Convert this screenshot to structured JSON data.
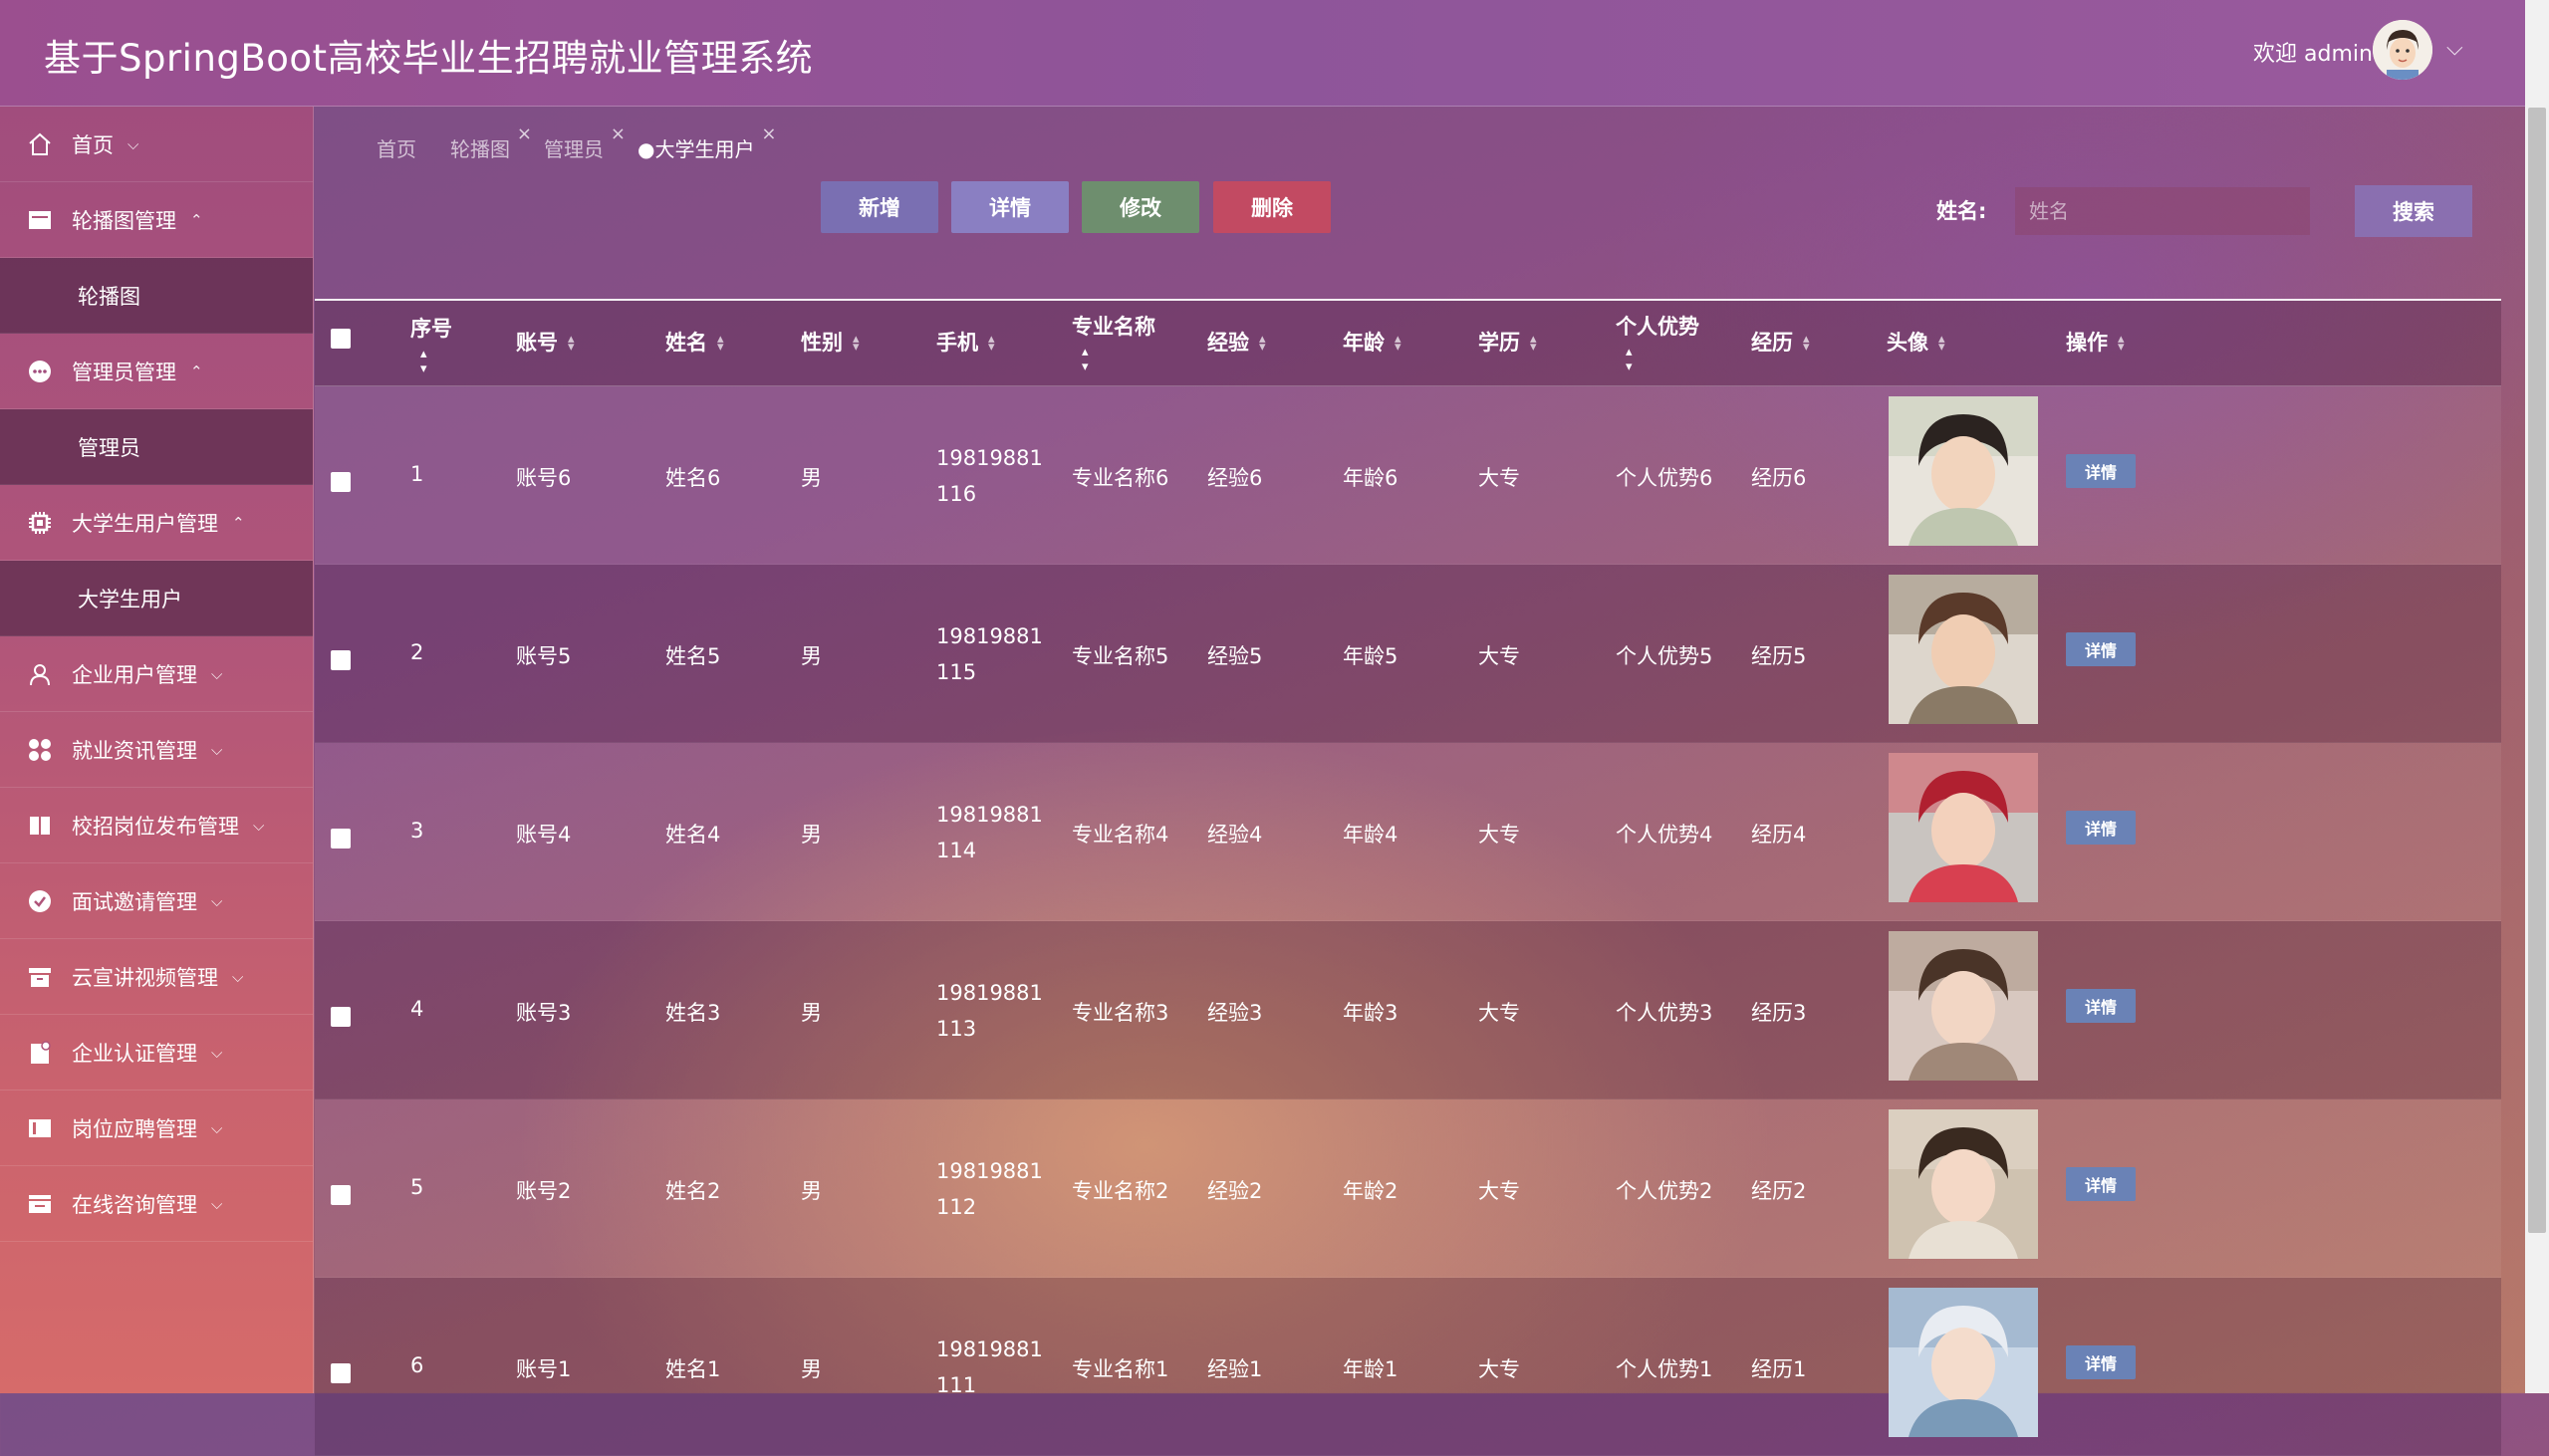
{
  "app": {
    "title": "基于SpringBoot高校毕业生招聘就业管理系统",
    "welcome": "欢迎 admin"
  },
  "sidebar": {
    "items": [
      {
        "label": "首页",
        "icon": "home-icon",
        "expanded": false
      },
      {
        "label": "轮播图管理",
        "icon": "image-icon",
        "expanded": true,
        "sub": "轮播图"
      },
      {
        "label": "管理员管理",
        "icon": "chat-bubble-icon",
        "expanded": true,
        "sub": "管理员"
      },
      {
        "label": "大学生用户管理",
        "icon": "chip-icon",
        "expanded": true,
        "sub": "大学生用户"
      },
      {
        "label": "企业用户管理",
        "icon": "user-icon",
        "expanded": false
      },
      {
        "label": "就业资讯管理",
        "icon": "grid-icon",
        "expanded": false
      },
      {
        "label": "校招岗位发布管理",
        "icon": "book-icon",
        "expanded": false
      },
      {
        "label": "面试邀请管理",
        "icon": "check-circle-icon",
        "expanded": false
      },
      {
        "label": "云宣讲视频管理",
        "icon": "archive-icon",
        "expanded": false
      },
      {
        "label": "企业认证管理",
        "icon": "document-icon",
        "expanded": false
      },
      {
        "label": "岗位应聘管理",
        "icon": "panel-icon",
        "expanded": false
      },
      {
        "label": "在线咨询管理",
        "icon": "tray-icon",
        "expanded": false
      }
    ]
  },
  "tabs": [
    {
      "label": "首页",
      "closable": false,
      "active": false
    },
    {
      "label": "轮播图",
      "closable": true,
      "active": false
    },
    {
      "label": "管理员",
      "closable": true,
      "active": false
    },
    {
      "label": "●大学生用户",
      "closable": true,
      "active": true
    }
  ],
  "toolbar": {
    "add_label": "新增",
    "detail_label": "详情",
    "edit_label": "修改",
    "delete_label": "删除",
    "search_label": "姓名:",
    "search_placeholder": "姓名",
    "search_button": "搜索",
    "colors": {
      "add": "#7a6fb2",
      "detail": "#8a7fc2",
      "edit": "#6e8e6e",
      "delete": "#c24a62"
    }
  },
  "table": {
    "headers": {
      "index": "序号",
      "account": "账号",
      "name": "姓名",
      "gender": "性别",
      "phone": "手机",
      "major": "专业名称",
      "experience": "经验",
      "age": "年龄",
      "education": "学历",
      "advantage": "个人优势",
      "history": "经历",
      "avatar": "头像",
      "actions": "操作"
    },
    "rows": [
      {
        "index": "1",
        "account": "账号6",
        "name": "姓名6",
        "gender": "男",
        "phone": "19819881116",
        "major": "专业名称6",
        "experience": "经验6",
        "age": "年龄6",
        "education": "大专",
        "advantage": "个人优势6",
        "history": "经历6",
        "action": "详情"
      },
      {
        "index": "2",
        "account": "账号5",
        "name": "姓名5",
        "gender": "男",
        "phone": "19819881115",
        "major": "专业名称5",
        "experience": "经验5",
        "age": "年龄5",
        "education": "大专",
        "advantage": "个人优势5",
        "history": "经历5",
        "action": "详情"
      },
      {
        "index": "3",
        "account": "账号4",
        "name": "姓名4",
        "gender": "男",
        "phone": "19819881114",
        "major": "专业名称4",
        "experience": "经验4",
        "age": "年龄4",
        "education": "大专",
        "advantage": "个人优势4",
        "history": "经历4",
        "action": "详情"
      },
      {
        "index": "4",
        "account": "账号3",
        "name": "姓名3",
        "gender": "男",
        "phone": "19819881113",
        "major": "专业名称3",
        "experience": "经验3",
        "age": "年龄3",
        "education": "大专",
        "advantage": "个人优势3",
        "history": "经历3",
        "action": "详情"
      },
      {
        "index": "5",
        "account": "账号2",
        "name": "姓名2",
        "gender": "男",
        "phone": "19819881112",
        "major": "专业名称2",
        "experience": "经验2",
        "age": "年龄2",
        "education": "大专",
        "advantage": "个人优势2",
        "history": "经历2",
        "action": "详情"
      },
      {
        "index": "6",
        "account": "账号1",
        "name": "姓名1",
        "gender": "男",
        "phone": "19819881111",
        "major": "专业名称1",
        "experience": "经验1",
        "age": "年龄1",
        "education": "大专",
        "advantage": "个人优势1",
        "history": "经历1",
        "action": "详情"
      }
    ]
  }
}
